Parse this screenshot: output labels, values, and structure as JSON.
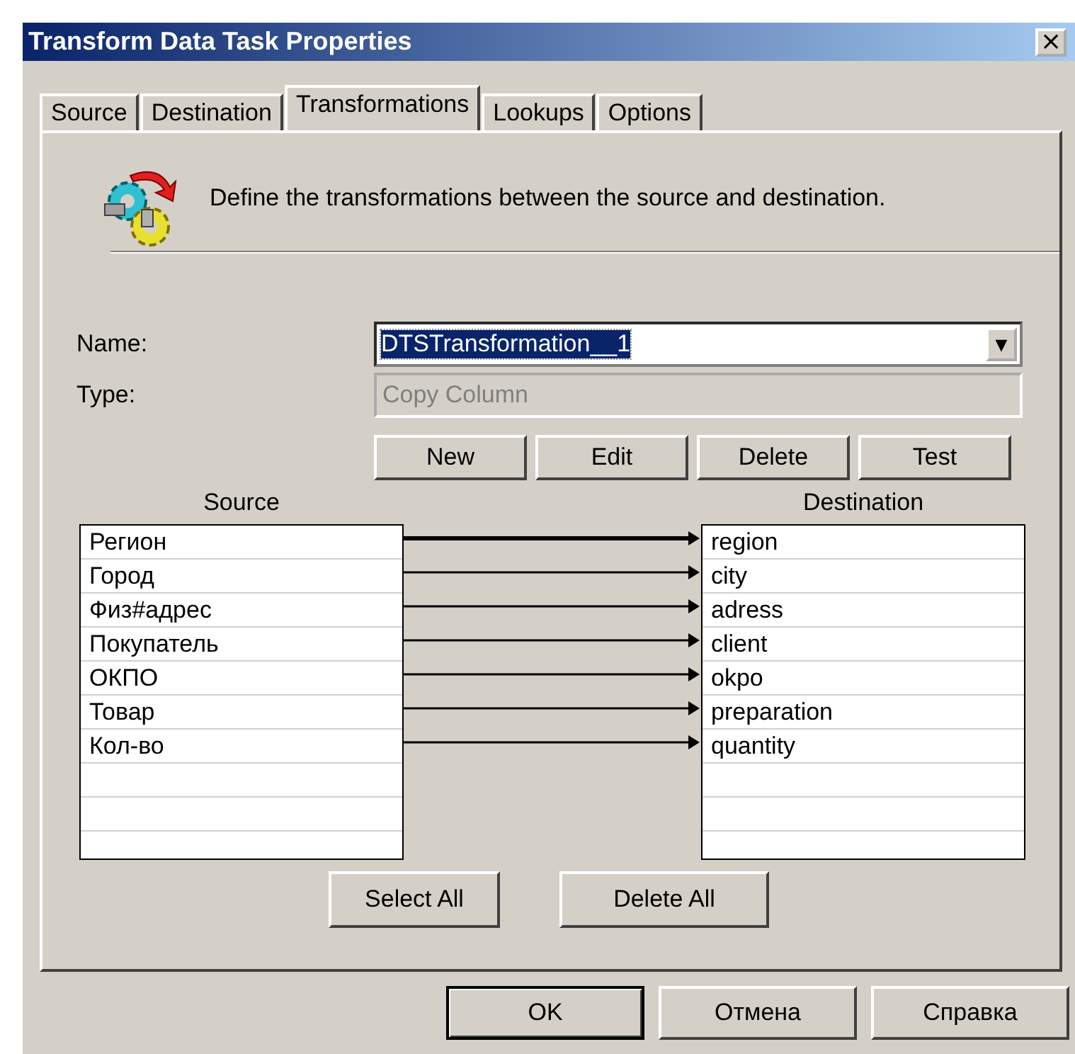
{
  "window": {
    "title": "Transform Data Task Properties",
    "close": "×"
  },
  "tabs": [
    {
      "label": "Source",
      "selected": false
    },
    {
      "label": "Destination",
      "selected": false
    },
    {
      "label": "Transformations",
      "selected": true
    },
    {
      "label": "Lookups",
      "selected": false
    },
    {
      "label": "Options",
      "selected": false
    }
  ],
  "description": "Define the transformations between the source and destination.",
  "name_field": {
    "label": "Name:",
    "value": "DTSTransformation__1",
    "dropdown": "▼"
  },
  "type_field": {
    "label": "Type:",
    "value": "Copy Column",
    "disabled": true
  },
  "action_buttons": [
    "New",
    "Edit",
    "Delete",
    "Test"
  ],
  "source": {
    "title": "Source",
    "columns": [
      "Регион",
      "Город",
      "Физ#адрес",
      "Покупатель",
      "ОКПО",
      "Товар",
      "Кол-во"
    ]
  },
  "destination": {
    "title": "Destination",
    "columns": [
      "region",
      "city",
      "adress",
      "client",
      "okpo",
      "preparation",
      "quantity"
    ]
  },
  "transformations": [
    {
      "selected": true
    },
    {
      "selected": false
    },
    {
      "selected": false
    },
    {
      "selected": false
    },
    {
      "selected": false
    },
    {
      "selected": false
    },
    {
      "selected": false
    }
  ],
  "list_buttons": [
    "Select All",
    "Delete All"
  ],
  "dialog_buttons": [
    {
      "label": "OK",
      "default": true
    },
    {
      "label": "Отмена",
      "default": false
    },
    {
      "label": "Справка",
      "default": false
    }
  ]
}
